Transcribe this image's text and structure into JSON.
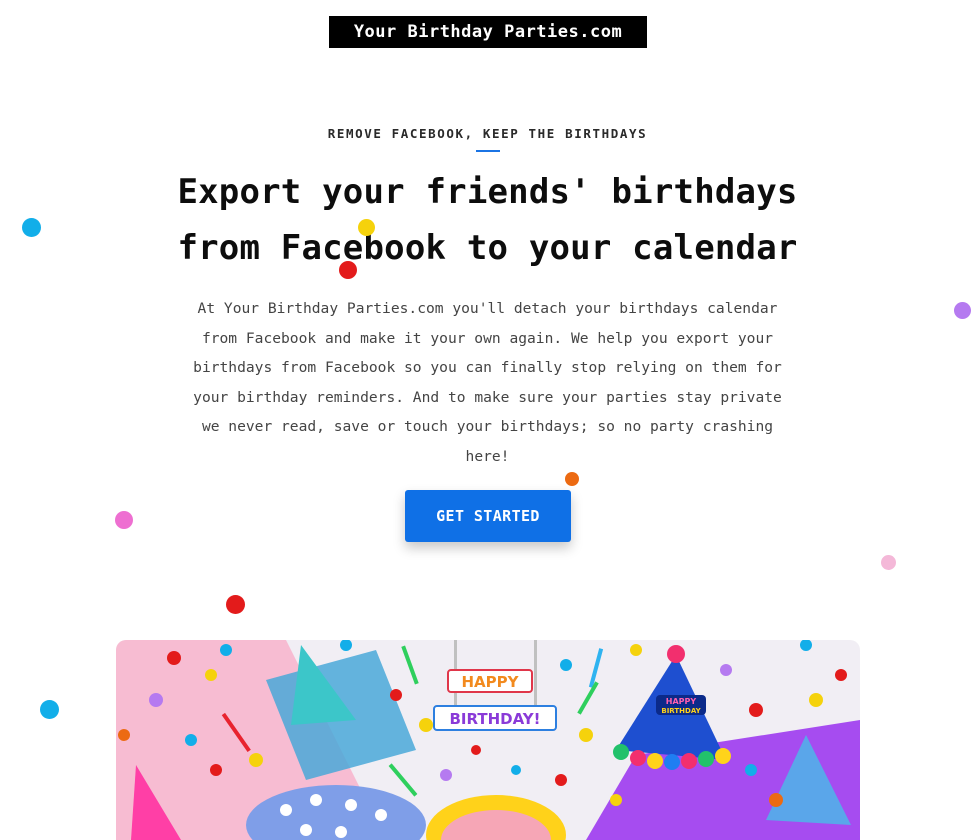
{
  "brand": {
    "logo_text": "Your Birthday Parties.com"
  },
  "hero": {
    "eyebrow": "REMOVE FACEBOOK, KEEP THE BIRTHDAYS",
    "headline_line1": "Export your friends' birthdays",
    "headline_line2": "from Facebook to your calendar",
    "intro": "At Your Birthday Parties.com you'll detach your birthdays calendar from Facebook and make it your own again. We help you export your birthdays from Facebook so you can finally stop relying on them for your birthday reminders. And to make sure your parties stay private we never read, save or touch your birthdays; so no party crashing here!",
    "cta_label": "GET STARTED"
  },
  "image": {
    "banner_word1": "HAPPY",
    "banner_word2": "BIRTHDAY!",
    "hat_text_line1": "HAPPY",
    "hat_text_line2": "BIRTHDAY"
  },
  "colors": {
    "accent": "#0f70e6",
    "logo_bg": "#000000",
    "confetti": [
      "#12aee9",
      "#f5d20c",
      "#e31b1b",
      "#b57af0",
      "#ee6fd1",
      "#ec6a12",
      "#f4b8d8"
    ]
  }
}
